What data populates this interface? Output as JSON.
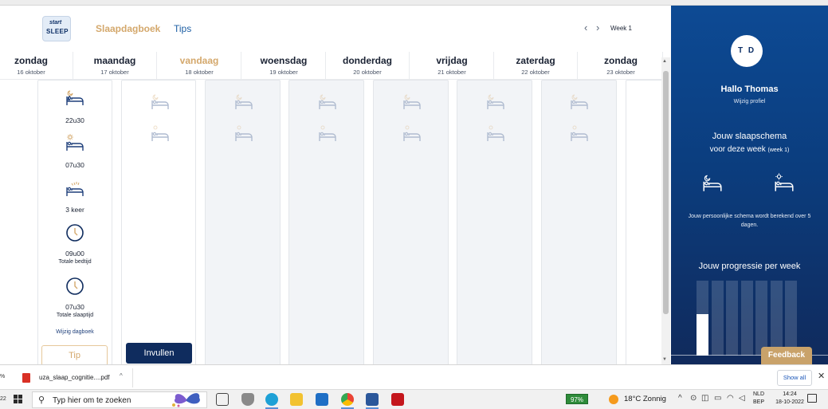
{
  "header": {
    "logo_text_top": "start",
    "logo_text_bottom": "SLEEP",
    "nav_diary": "Slaapdagboek",
    "nav_tips": "Tips",
    "prev_icon": "chevron-left-icon",
    "next_icon": "chevron-right-icon",
    "week_label": "Week 1"
  },
  "days": [
    {
      "name": "zondag",
      "date": "16 oktober"
    },
    {
      "name": "maandag",
      "date": "17 oktober"
    },
    {
      "name": "vandaag",
      "date": "18 oktober"
    },
    {
      "name": "woensdag",
      "date": "19 oktober"
    },
    {
      "name": "donderdag",
      "date": "20 oktober"
    },
    {
      "name": "vrijdag",
      "date": "21 oktober"
    },
    {
      "name": "zaterdag",
      "date": "22 oktober"
    },
    {
      "name": "zondag",
      "date": "23 oktober"
    }
  ],
  "entry": {
    "bedtime": "22u30",
    "wake_time": "07u30",
    "wake_count": "3 keer",
    "total_bed": "09u00",
    "total_bed_label": "Totale bedtijd",
    "total_sleep": "07u30",
    "total_sleep_label": "Totale slaaptijd",
    "edit_link": "Wijzig dagboek"
  },
  "buttons": {
    "tip": "Tip",
    "fill": "Invullen"
  },
  "panel": {
    "initials": "T D",
    "greeting": "Hallo Thomas",
    "edit_profile": "Wijzig profiel",
    "schedule_line1": "Jouw slaapschema",
    "schedule_line2": "voor deze week",
    "schedule_week": "(week 1)",
    "note": "Jouw persoonlijke schema wordt berekend over 5 dagen.",
    "progress_title": "Jouw progressie per week",
    "progress_bars": [
      0.55,
      0,
      0,
      0,
      0,
      0,
      0
    ],
    "feedback": "Feedback"
  },
  "downloads": {
    "edge_text": "%",
    "file_name": "uza_slaap_cognitie....pdf",
    "show_all": "Show all"
  },
  "taskbar": {
    "edge_text": "22",
    "search_placeholder": "Typ hier om te zoeken",
    "battery": "97%",
    "weather": "18°C  Zonnig",
    "lang_line1": "NLD",
    "lang_line2": "BEP",
    "time": "14:24",
    "date": "18-10-2022"
  },
  "colors": {
    "accent_gold": "#d4a86c",
    "navy": "#0f2c5e",
    "panel_blue": "#0d4a94"
  }
}
